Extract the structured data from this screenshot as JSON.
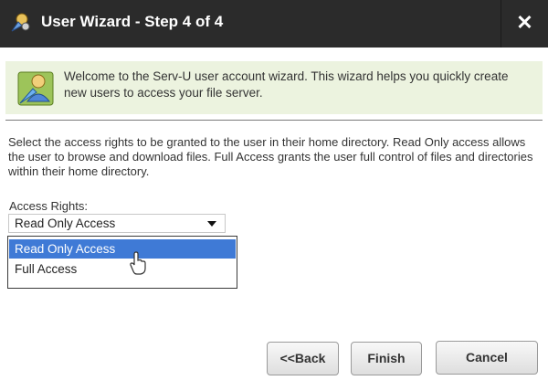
{
  "window": {
    "title": "User Wizard - Step 4 of 4",
    "close_label": "✕"
  },
  "banner": {
    "text": "Welcome to the Serv-U user account wizard. This wizard helps you quickly create new users to access your file server."
  },
  "description": "Select the access rights to be granted to the user in their home directory. Read Only access allows the user to browse and download files. Full Access grants the user full control of files and directories within their home directory.",
  "access_rights": {
    "label": "Access Rights:",
    "selected": "Read Only Access",
    "options": [
      "Read Only Access",
      "Full Access"
    ]
  },
  "buttons": {
    "back": "<<Back",
    "finish": "Finish",
    "cancel": "Cancel"
  },
  "colors": {
    "titlebar": "#2b2b2b",
    "banner_bg": "#ecf3df",
    "selection": "#3f7ad6"
  },
  "icons": {
    "title": "wizard-icon",
    "banner": "user-wizard-icon",
    "dropdown": "triangle-down-icon",
    "close": "close-icon"
  }
}
